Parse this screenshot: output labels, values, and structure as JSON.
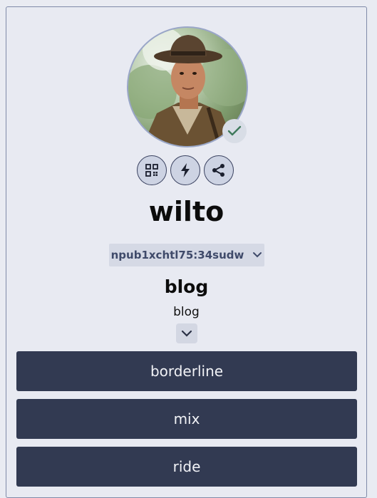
{
  "profile": {
    "username": "wilto",
    "npub": "npub1xchtl75:34sudw",
    "bio_title": "blog",
    "bio_text": "blog"
  },
  "actions": [
    {
      "name": "qr-code",
      "icon": "qr-code-icon"
    },
    {
      "name": "zap",
      "icon": "lightning-icon"
    },
    {
      "name": "share",
      "icon": "share-icon"
    }
  ],
  "links": [
    {
      "label": "borderline"
    },
    {
      "label": "mix"
    },
    {
      "label": "ride"
    }
  ],
  "colors": {
    "background": "#e9ebf2",
    "link_button": "#323a52",
    "verified_check": "#3f7a5c"
  }
}
